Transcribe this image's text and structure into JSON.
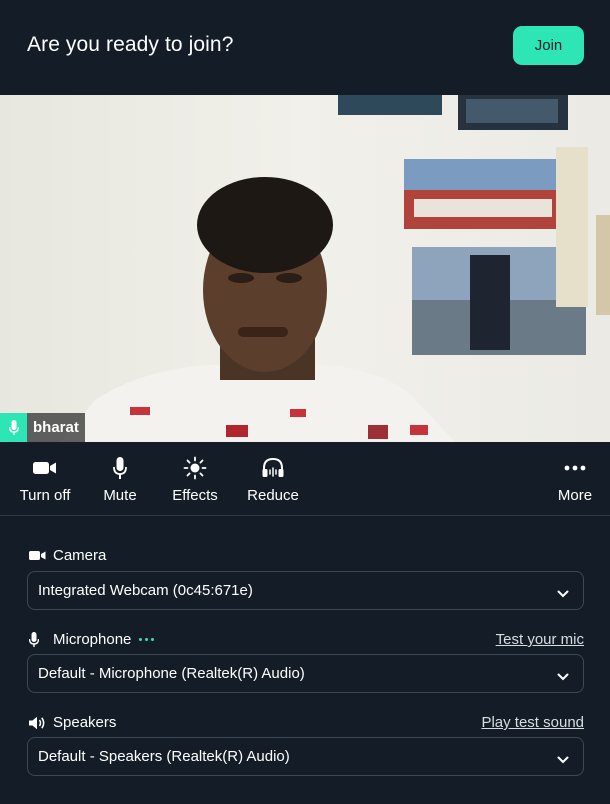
{
  "header": {
    "title": "Are you ready to join?",
    "join_label": "Join"
  },
  "video": {
    "participant_name": "bharat"
  },
  "toolbar": {
    "camera": {
      "label": "Turn off",
      "icon": "video-camera-icon"
    },
    "mic": {
      "label": "Mute",
      "icon": "microphone-icon"
    },
    "effects": {
      "label": "Effects",
      "icon": "sparkle-icon"
    },
    "noise": {
      "label": "Reduce",
      "icon": "headphones-icon"
    },
    "more": {
      "label": "More",
      "icon": "more-dots-icon"
    }
  },
  "settings": {
    "camera": {
      "label": "Camera",
      "selected": "Integrated Webcam (0c45:671e)"
    },
    "microphone": {
      "label": "Microphone",
      "selected": "Default - Microphone (Realtek(R) Audio)",
      "test_link": "Test your mic"
    },
    "speakers": {
      "label": "Speakers",
      "selected": "Default - Speakers (Realtek(R) Audio)",
      "test_link": "Play test sound"
    }
  },
  "colors": {
    "background": "#141d27",
    "accent": "#2ee5b5",
    "border": "#3b4856"
  }
}
